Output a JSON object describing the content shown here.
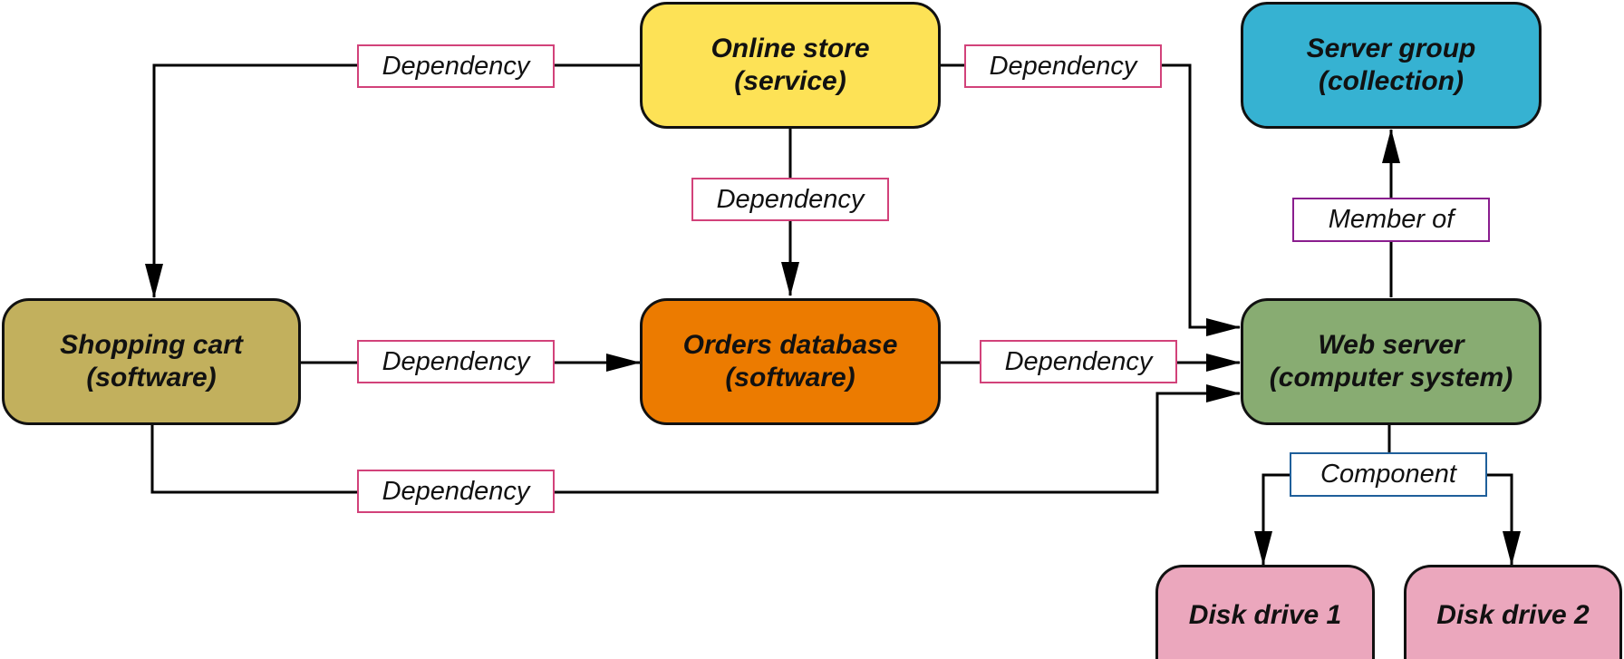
{
  "nodes": {
    "online_store": {
      "line1": "Online store",
      "line2": "(service)",
      "color": "#fde256"
    },
    "server_group": {
      "line1": "Server group",
      "line2": "(collection)",
      "color": "#36b2d2"
    },
    "shopping_cart": {
      "line1": "Shopping cart",
      "line2": "(software)",
      "color": "#c2b05d"
    },
    "orders_db": {
      "line1": "Orders database",
      "line2": "(software)",
      "color": "#ec7b00"
    },
    "web_server": {
      "line1": "Web server",
      "line2": "(computer system)",
      "color": "#88ac72"
    },
    "disk1": {
      "line1": "Disk drive 1",
      "color": "#eba7bd"
    },
    "disk2": {
      "line1": "Disk drive 2",
      "color": "#eba7bd"
    }
  },
  "edges": [
    {
      "from": "online_store",
      "to": "shopping_cart",
      "label": "Dependency"
    },
    {
      "from": "online_store",
      "to": "orders_db",
      "label": "Dependency"
    },
    {
      "from": "online_store",
      "to": "web_server",
      "label": "Dependency"
    },
    {
      "from": "shopping_cart",
      "to": "orders_db",
      "label": "Dependency"
    },
    {
      "from": "orders_db",
      "to": "web_server",
      "label": "Dependency"
    },
    {
      "from": "shopping_cart",
      "to": "web_server",
      "label": "Dependency"
    },
    {
      "from": "web_server",
      "to": "server_group",
      "label": "Member of"
    },
    {
      "from": "web_server",
      "to": "disk1",
      "label": "Component"
    },
    {
      "from": "web_server",
      "to": "disk2",
      "label": "Component"
    }
  ]
}
